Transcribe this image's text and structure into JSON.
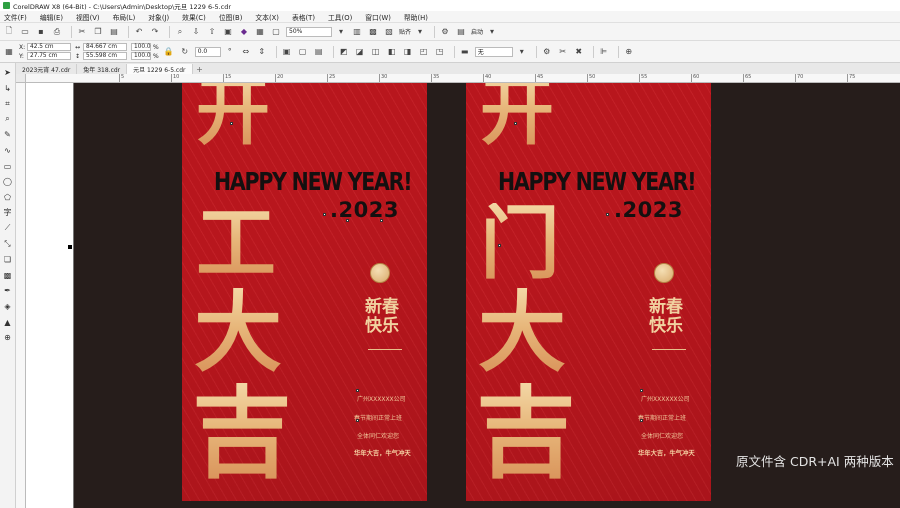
{
  "window": {
    "title": "CorelDRAW X8 (64-Bit) - C:\\Users\\Admin\\Desktop\\元旦 1229 6-5.cdr"
  },
  "menu": [
    "文件(F)",
    "编辑(E)",
    "视图(V)",
    "布局(L)",
    "对象(J)",
    "效果(C)",
    "位图(B)",
    "文本(X)",
    "表格(T)",
    "工具(O)",
    "窗口(W)",
    "帮助(H)"
  ],
  "toolbar1": {
    "zoom": "50%",
    "snap_label": "贴齐",
    "launch_label": "启动"
  },
  "toolbar2": {
    "x": "42.5 cm",
    "y": "27.75 cm",
    "width": "84.667 cm",
    "height": "55.598 cm",
    "scale_x": "100.0",
    "scale_y": "100.0",
    "pct": "%",
    "angle": "0.0",
    "outline": "无"
  },
  "tabs": [
    "2023元宵 47.cdr",
    "兔年 318.cdr",
    "元旦 1229 6-5.cdr"
  ],
  "ruler_ticks": [
    "5",
    "10",
    "15",
    "20",
    "25",
    "30",
    "35",
    "40",
    "45",
    "50",
    "55",
    "60",
    "65",
    "70",
    "75",
    "80",
    "85"
  ],
  "poster_left": {
    "chars": [
      "开",
      "工",
      "大",
      "吉"
    ],
    "headline": "HAPPY NEW YEAR!",
    "year": ".2023",
    "greeting": [
      "新春",
      "快乐"
    ],
    "lines": [
      "广州XXXXXX公司",
      "春节期间正常上班",
      "全体同仁欢迎您",
      "华年大吉，牛气冲天"
    ]
  },
  "poster_right": {
    "chars": [
      "开",
      "门",
      "大",
      "吉"
    ],
    "headline": "HAPPY NEW YEAR!",
    "year": ".2023",
    "greeting": [
      "新春",
      "快乐"
    ],
    "lines": [
      "广州XXXXXX公司",
      "春节期间正常上班",
      "全体同仁欢迎您",
      "华年大吉，牛气冲天"
    ]
  },
  "watermark": "原文件含 CDR+AI 两种版本",
  "colors": {
    "poster_red": "#b8161d",
    "gold": "#ecc48a",
    "workspace": "#261d1b"
  }
}
